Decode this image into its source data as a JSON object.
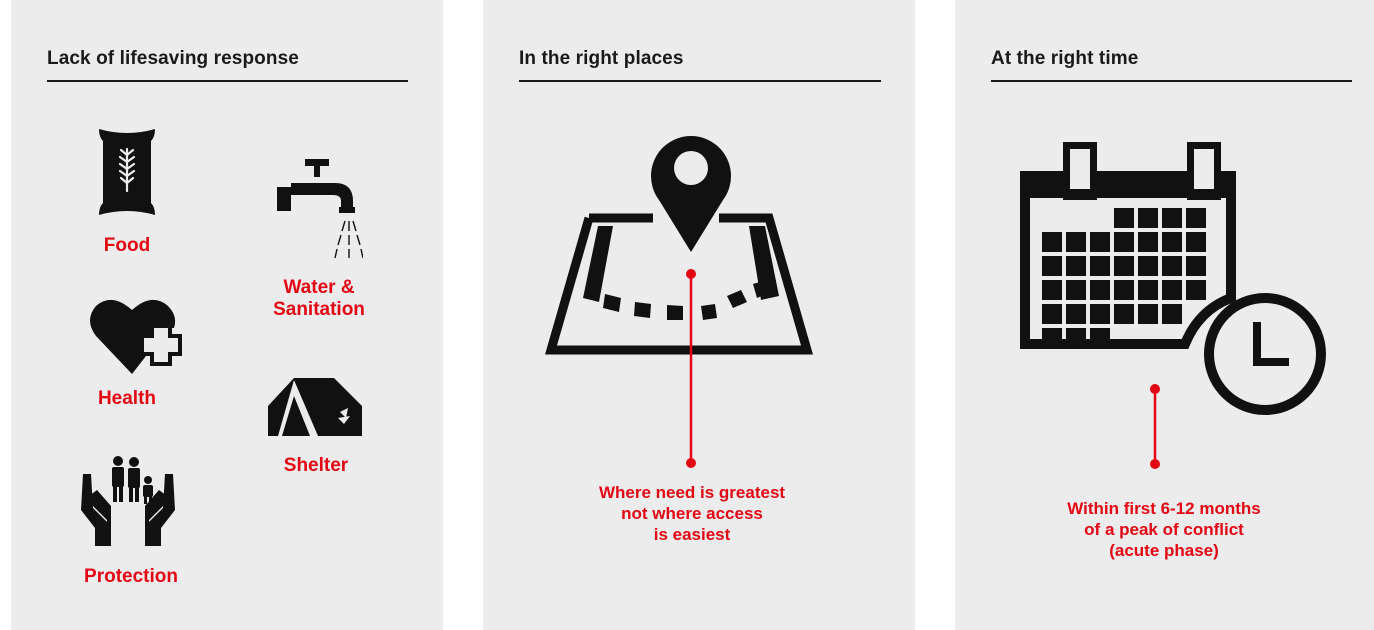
{
  "panels": [
    {
      "title": "Lack of lifesaving response",
      "needs": [
        {
          "label": "Food",
          "icon": "food-sack-icon"
        },
        {
          "label_lines": [
            "Water &",
            "Sanitation"
          ],
          "icon": "water-tap-icon"
        },
        {
          "label": "Health",
          "icon": "health-heart-icon"
        },
        {
          "label": "Shelter",
          "icon": "tent-icon"
        },
        {
          "label": "Protection",
          "icon": "protection-hands-icon"
        }
      ]
    },
    {
      "title": "In the right places",
      "icon": "map-pin-icon",
      "caption_lines": [
        "Where need is greatest",
        "not where access",
        "is easiest"
      ]
    },
    {
      "title": "At the right time",
      "icon": "calendar-clock-icon",
      "caption_lines": [
        "Within first 6-12 months",
        "of a peak of conflict",
        "(acute phase)"
      ]
    }
  ],
  "colors": {
    "accent": "#e30613",
    "panel_bg": "#ececec",
    "ink": "#1a1a1a"
  }
}
